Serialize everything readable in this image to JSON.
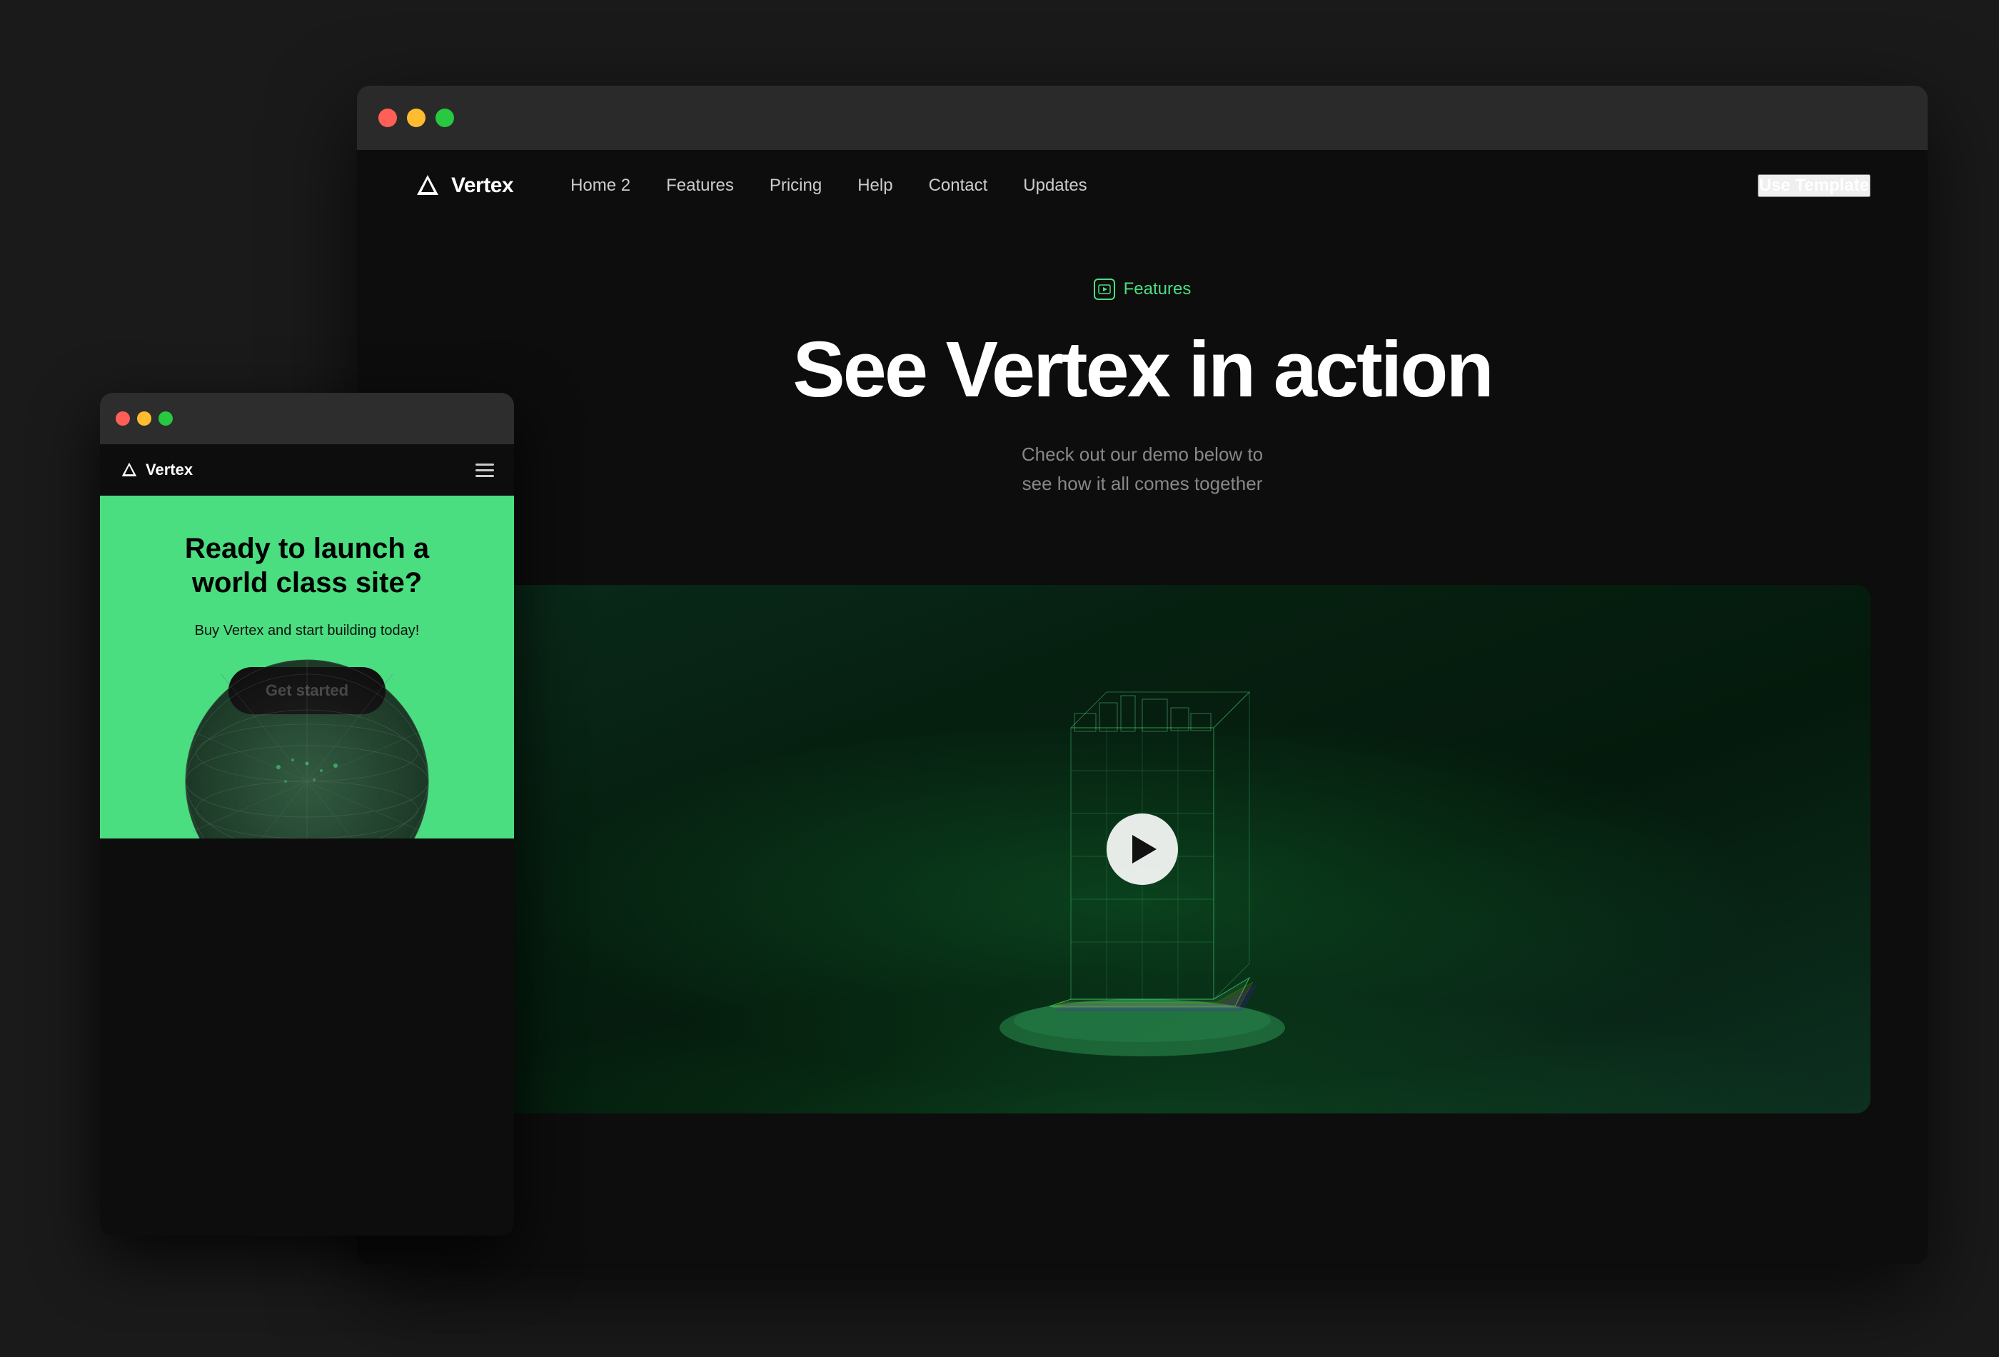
{
  "desktop": {
    "nav": {
      "logo": "Vertex",
      "links": [
        "Home 2",
        "Features",
        "Pricing",
        "Help",
        "Contact",
        "Updates"
      ],
      "cta": "Use Template"
    },
    "hero": {
      "badge_icon": "▶",
      "badge_text": "Features",
      "title": "See Vertex in action",
      "subtitle_line1": "Check out our demo below to",
      "subtitle_line2": "see how it all comes together"
    },
    "video": {
      "play_label": "Play video"
    }
  },
  "mobile": {
    "nav": {
      "logo": "Vertex",
      "menu_icon": "hamburger"
    },
    "hero": {
      "title_line1": "Ready to launch a",
      "title_line2": "world class site?",
      "subtitle": "Buy Vertex and start building today!",
      "cta": "Get started"
    }
  },
  "colors": {
    "accent": "#4ade80",
    "bg_dark": "#0d0d0d",
    "bg_browser": "#2a2a2a",
    "text_light": "#ffffff",
    "text_muted": "#888888"
  }
}
